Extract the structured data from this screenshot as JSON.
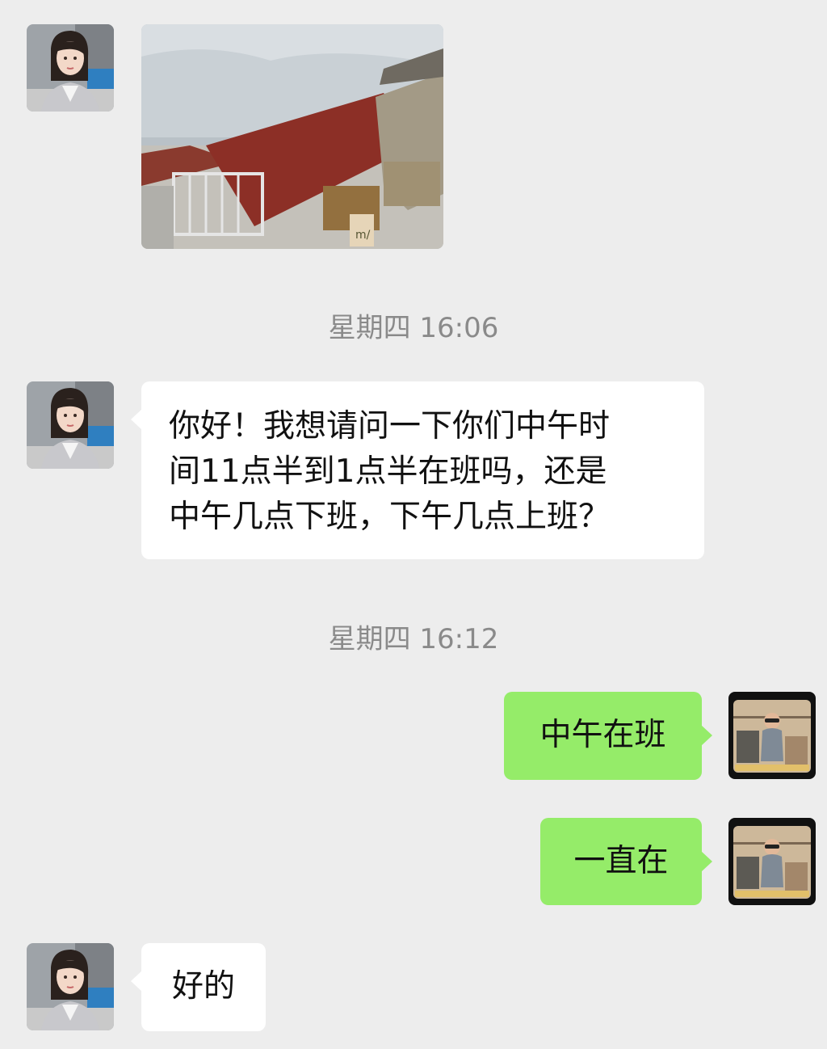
{
  "messages": [
    {
      "id": "m1",
      "side": "left",
      "kind": "image",
      "avatar": "contact-avatar",
      "image": "rooftop-photo"
    },
    {
      "id": "t1",
      "kind": "timestamp",
      "text": "星期四 16:06"
    },
    {
      "id": "m2",
      "side": "left",
      "kind": "text",
      "avatar": "contact-avatar",
      "lines": [
        "你好！我想请问一下你们中午时",
        "间11点半到1点半在班吗，还是",
        "中午几点下班，下午几点上班？"
      ]
    },
    {
      "id": "t2",
      "kind": "timestamp",
      "text": "星期四 16:12"
    },
    {
      "id": "m3",
      "side": "right",
      "kind": "text",
      "avatar": "self-avatar",
      "lines": [
        "中午在班"
      ]
    },
    {
      "id": "m4",
      "side": "right",
      "kind": "text",
      "avatar": "self-avatar",
      "lines": [
        "一直在"
      ]
    },
    {
      "id": "m5",
      "side": "left",
      "kind": "text",
      "avatar": "contact-avatar",
      "lines": [
        "好的"
      ]
    }
  ],
  "photo_caption": "m/",
  "colors": {
    "background": "#ededed",
    "incoming_bubble": "#ffffff",
    "outgoing_bubble": "#95ec69",
    "timestamp_text": "#8a8a8a"
  }
}
